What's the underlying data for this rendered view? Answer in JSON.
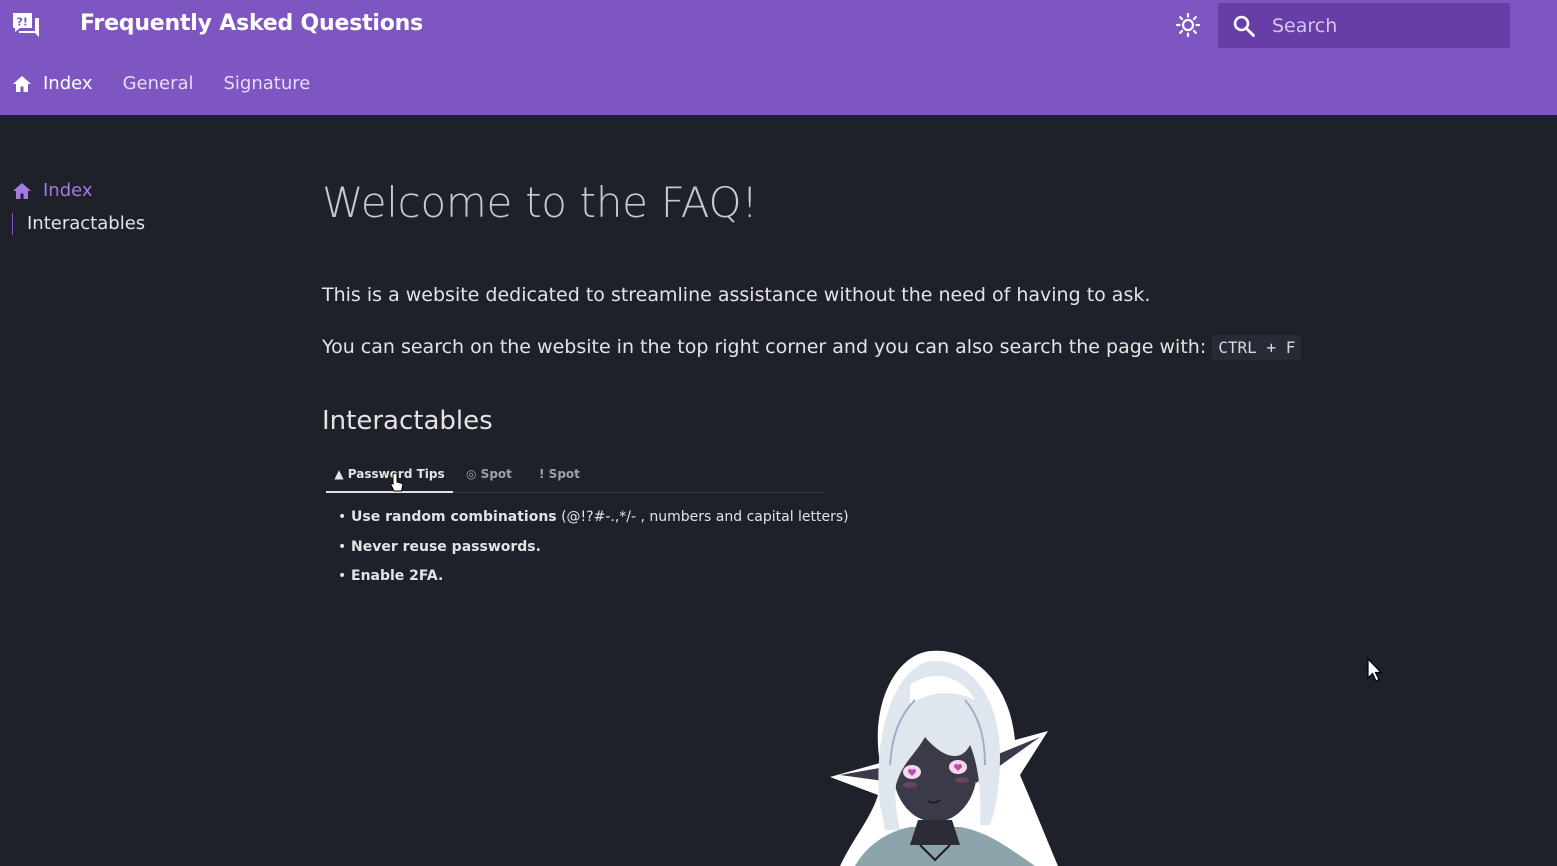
{
  "header": {
    "title": "Frequently Asked Questions",
    "search_placeholder": "Search"
  },
  "nav_tabs": [
    {
      "label": "Index",
      "active": true
    },
    {
      "label": "General",
      "active": false
    },
    {
      "label": "Signature",
      "active": false
    }
  ],
  "sidebar": {
    "items": [
      {
        "label": "Index",
        "active": true
      },
      {
        "label": "Interactables",
        "active": false
      }
    ]
  },
  "main": {
    "title": "Welcome to the FAQ!",
    "intro": "This is a website dedicated to streamline assistance without the need of having to ask.",
    "search_hint": "You can search on the website in the top right corner and you can also search the page with:",
    "search_shortcut": "CTRL + F",
    "section_title": "Interactables",
    "interactable_tabs": [
      {
        "label": "Password Tips",
        "icon": "warning-icon",
        "active": true
      },
      {
        "label": "Spot",
        "icon": "eye-icon",
        "active": false
      },
      {
        "label": "Spot",
        "icon": "exclamation-icon",
        "active": false
      }
    ],
    "password_tips": [
      {
        "bold": "Use random combinations",
        "rest": " (@!?#-.,*/- , numbers and capital letters)"
      },
      {
        "bold": "Never reuse passwords.",
        "rest": ""
      },
      {
        "bold": "Enable 2FA.",
        "rest": ""
      }
    ]
  },
  "colors": {
    "header_bg": "#7e56c2",
    "page_bg": "#1e2129",
    "accent": "#a27be2",
    "search_bg": "#673ea8"
  }
}
